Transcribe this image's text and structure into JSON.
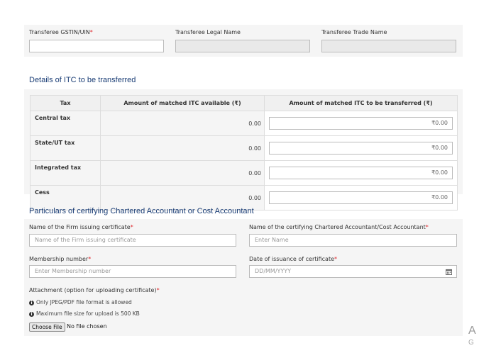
{
  "transferee": {
    "gstin_label": "Transferee GSTIN/UIN",
    "legal_name_label": "Transferee Legal Name",
    "trade_name_label": "Transferee Trade Name",
    "required_mark": "*"
  },
  "itc_section": {
    "heading": "Details of ITC to be transferred",
    "columns": [
      "Tax",
      "Amount of matched ITC available (₹)",
      "Amount of matched ITC to be transferred (₹)"
    ],
    "rows": [
      {
        "tax": "Central tax",
        "available": "0.00",
        "transfer": "₹0.00"
      },
      {
        "tax": "State/UT tax",
        "available": "0.00",
        "transfer": "₹0.00"
      },
      {
        "tax": "Integrated tax",
        "available": "0.00",
        "transfer": "₹0.00"
      },
      {
        "tax": "Cess",
        "available": "0.00",
        "transfer": "₹0.00"
      }
    ]
  },
  "ca_section": {
    "heading": "Particulars of certifying Chartered Accountant or Cost Accountant",
    "firm_label": "Name of the Firm issuing certificate",
    "firm_placeholder": "Name of the Firm issuing certificate",
    "ca_name_label": "Name of the certifying Chartered Accountant/Cost Accountant",
    "ca_name_placeholder": "Enter Name",
    "membership_label": "Membership number",
    "membership_placeholder": "Enter Membership number",
    "date_label": "Date of issuance of certificate",
    "date_placeholder": "DD/MM/YYYY",
    "attachment_label": "Attachment (option for uploading certificate)",
    "info_format": "Only JPEG/PDF file format is allowed",
    "info_size": "Maximum file size for upload is 500 KB",
    "choose_file": "Choose File",
    "no_file": "No file chosen"
  },
  "overlay": {
    "line1": "A",
    "line2": "G"
  },
  "colors": {
    "required": "#e0262b",
    "heading": "#1a3d75",
    "panel": "#f5f5f5"
  },
  "icons": {
    "calendar": "calendar-icon",
    "info": "info-icon"
  }
}
